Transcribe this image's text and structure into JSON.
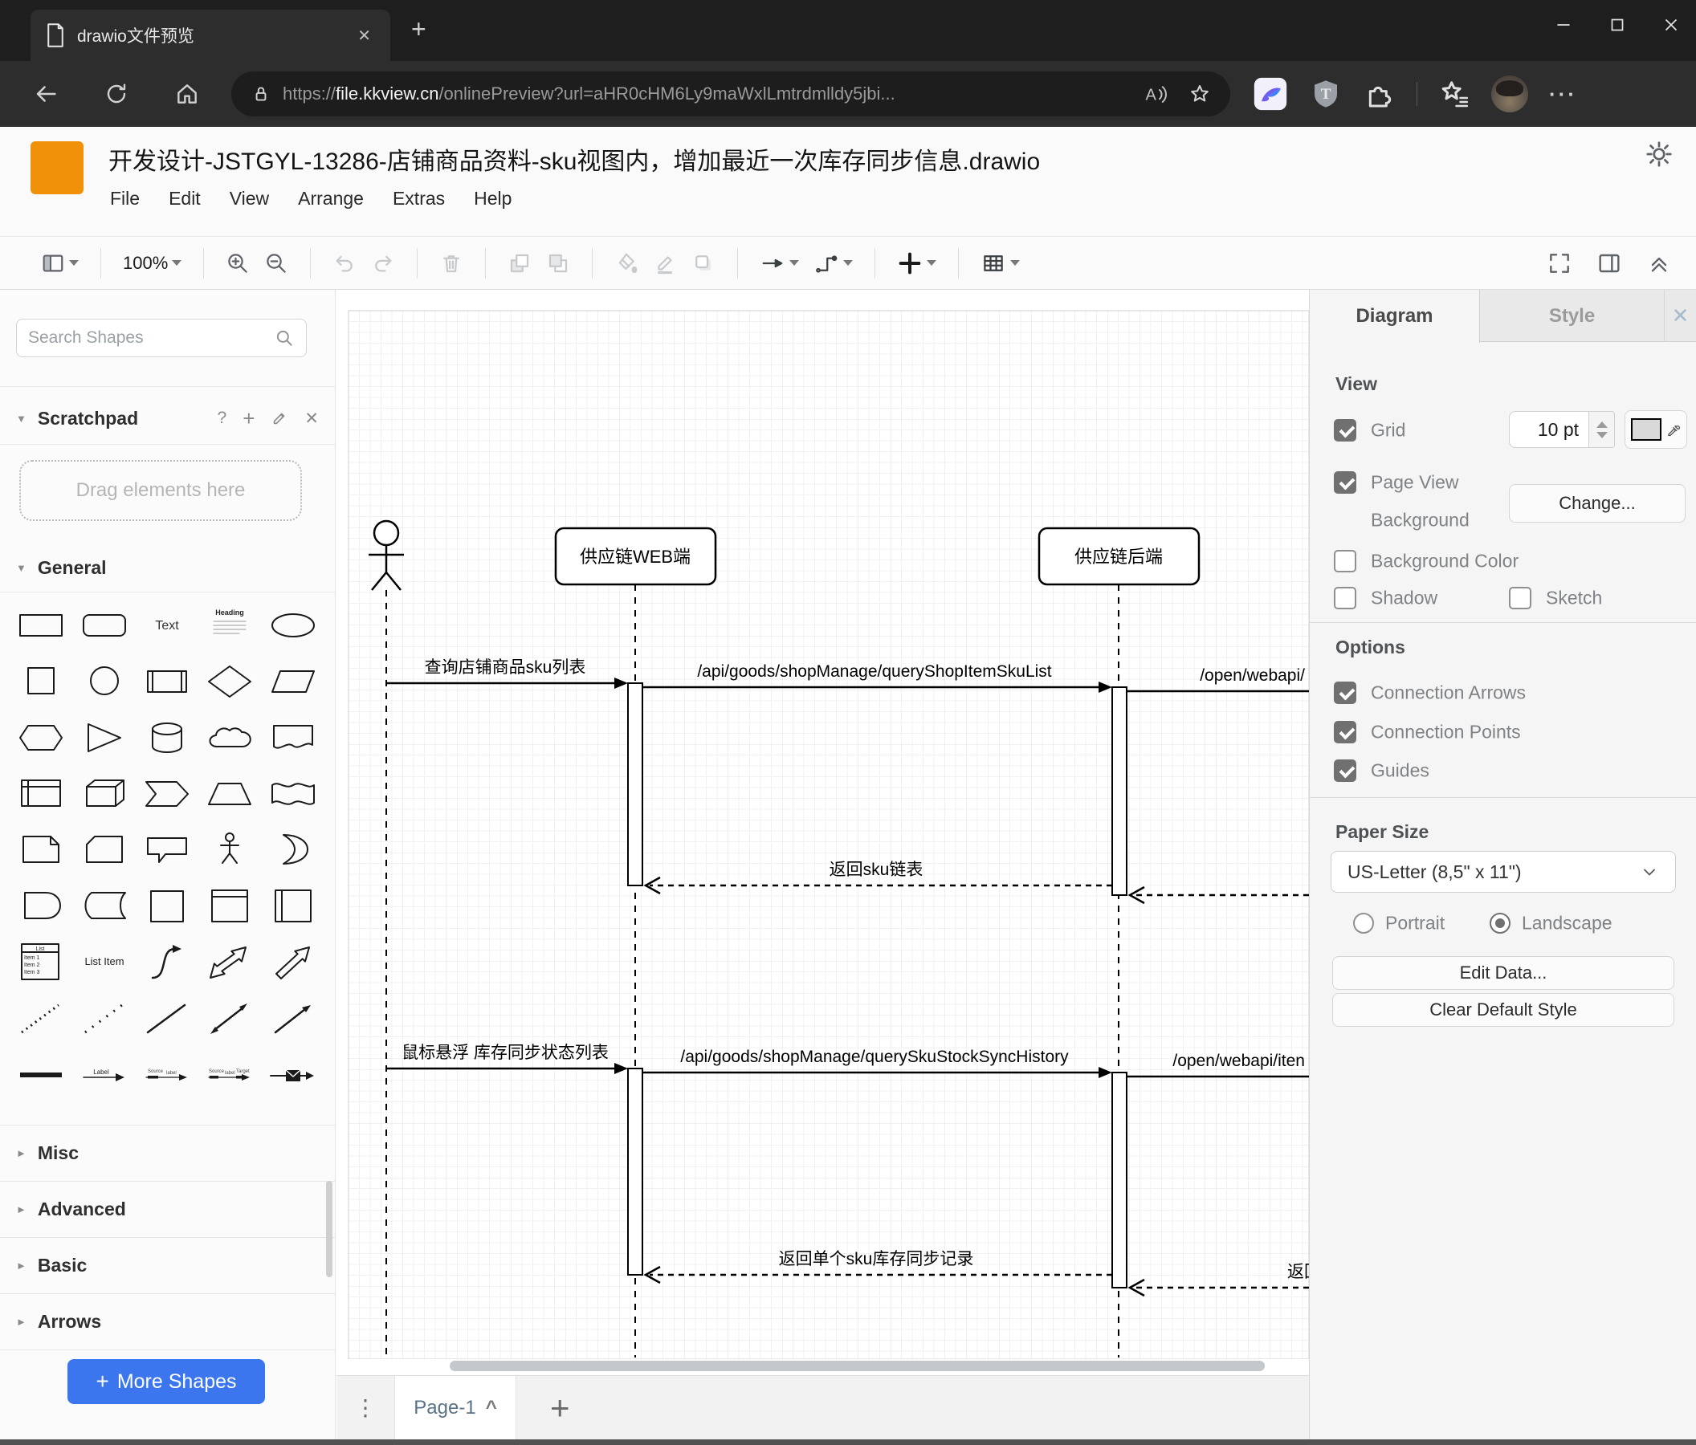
{
  "browser": {
    "tab_title": "drawio文件预览",
    "url_scheme": "https://",
    "url_host": "file.kkview.cn",
    "url_path": "/onlinePreview?url=aHR0cHM6Ly9maWxlLmtrdmlldy5jbi..."
  },
  "app": {
    "file_title": "开发设计-JSTGYL-13286-店铺商品资料-sku视图内，增加最近一次库存同步信息.drawio",
    "menus": [
      "File",
      "Edit",
      "View",
      "Arrange",
      "Extras",
      "Help"
    ],
    "zoom_level": "100%"
  },
  "sidebar": {
    "search_placeholder": "Search Shapes",
    "scratchpad_title": "Scratchpad",
    "scratchpad_hint": "Drag elements here",
    "general_title": "General",
    "collapsed_sections": [
      "Misc",
      "Advanced",
      "Basic",
      "Arrows"
    ],
    "more_shapes_label": "More Shapes",
    "accent_color": "#3b76ef",
    "shapes": [
      "rectangle",
      "rounded-rectangle",
      "text",
      "textbox",
      "ellipse",
      "square",
      "circle",
      "process",
      "diamond",
      "parallelogram",
      "hexagon",
      "triangle",
      "cylinder",
      "cloud",
      "document",
      "internal-storage",
      "cube",
      "step",
      "trapezoid",
      "tape",
      "note",
      "card",
      "callout",
      "actor",
      "or",
      "and",
      "data-storage",
      "container",
      "vertical-container",
      "horizontal-container",
      "list",
      "list-item",
      "curve",
      "bidirectional-arrow",
      "arrow",
      "dashed-line",
      "dotted-line",
      "line",
      "bidirectional-connector",
      "directional-connector",
      "horizontal-divider",
      "labeled-arrow",
      "link",
      "link-labels",
      "arrow-envelope"
    ]
  },
  "canvas": {
    "page_tab": "Page-1",
    "diagram": {
      "lifelines": [
        "供应链WEB端",
        "供应链后端"
      ],
      "messages": {
        "m1": "查询店铺商品sku列表",
        "m2": "/api/goods/shopManage/queryShopItemSkuList",
        "m3": "/open/webapi/",
        "r1": "返回sku链表",
        "m4": "鼠标悬浮 库存同步状态列表",
        "m5": "/api/goods/shopManage/querySkuStockSyncHistory",
        "m6": "/open/webapi/iten",
        "r2": "返回单个sku库存同步记录",
        "r3": "返回"
      }
    }
  },
  "panel": {
    "tab_diagram": "Diagram",
    "tab_style": "Style",
    "view_title": "View",
    "grid_label": "Grid",
    "grid_size": "10 pt",
    "page_view_label": "Page View",
    "background_label": "Background",
    "change_button": "Change...",
    "background_color_label": "Background Color",
    "shadow_label": "Shadow",
    "sketch_label": "Sketch",
    "options_title": "Options",
    "connection_arrows_label": "Connection Arrows",
    "connection_points_label": "Connection Points",
    "guides_label": "Guides",
    "paper_title": "Paper Size",
    "paper_value": "US-Letter (8,5\" x 11\")",
    "portrait_label": "Portrait",
    "landscape_label": "Landscape",
    "edit_data_button": "Edit Data...",
    "clear_style_button": "Clear Default Style"
  }
}
